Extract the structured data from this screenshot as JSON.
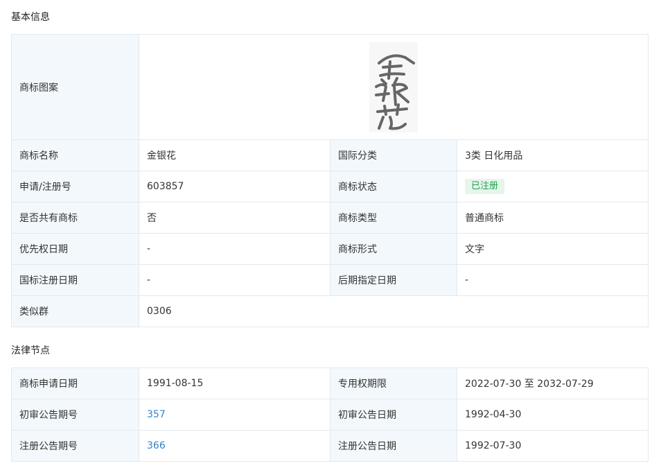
{
  "basic": {
    "section_title": "基本信息",
    "logo_label": "商标图案",
    "logo_text": "金银花",
    "rows": [
      {
        "l1": "商标名称",
        "v1": "金银花",
        "l2": "国际分类",
        "v2": "3类 日化用品"
      },
      {
        "l1": "申请/注册号",
        "v1": "603857",
        "l2": "商标状态",
        "v2": "已注册"
      },
      {
        "l1": "是否共有商标",
        "v1": "否",
        "l2": "商标类型",
        "v2": "普通商标"
      },
      {
        "l1": "优先权日期",
        "v1": "-",
        "l2": "商标形式",
        "v2": "文字"
      },
      {
        "l1": "国标注册日期",
        "v1": "-",
        "l2": "后期指定日期",
        "v2": "-"
      }
    ],
    "similar_label": "类似群",
    "similar_value": "0306"
  },
  "legal": {
    "section_title": "法律节点",
    "rows": [
      {
        "l1": "商标申请日期",
        "v1": "1991-08-15",
        "l2": "专用权期限",
        "v2": "2022-07-30 至 2032-07-29"
      },
      {
        "l1": "初审公告期号",
        "v1": "357",
        "l2": "初审公告日期",
        "v2": "1992-04-30"
      },
      {
        "l1": "注册公告期号",
        "v1": "366",
        "l2": "注册公告日期",
        "v2": "1992-07-30"
      }
    ]
  },
  "colors": {
    "label_bg": "#f2f8fc",
    "border": "#e4e8ee",
    "link": "#2f82d0",
    "status_green": "#23a04f",
    "status_bg": "#e5f6eb"
  }
}
